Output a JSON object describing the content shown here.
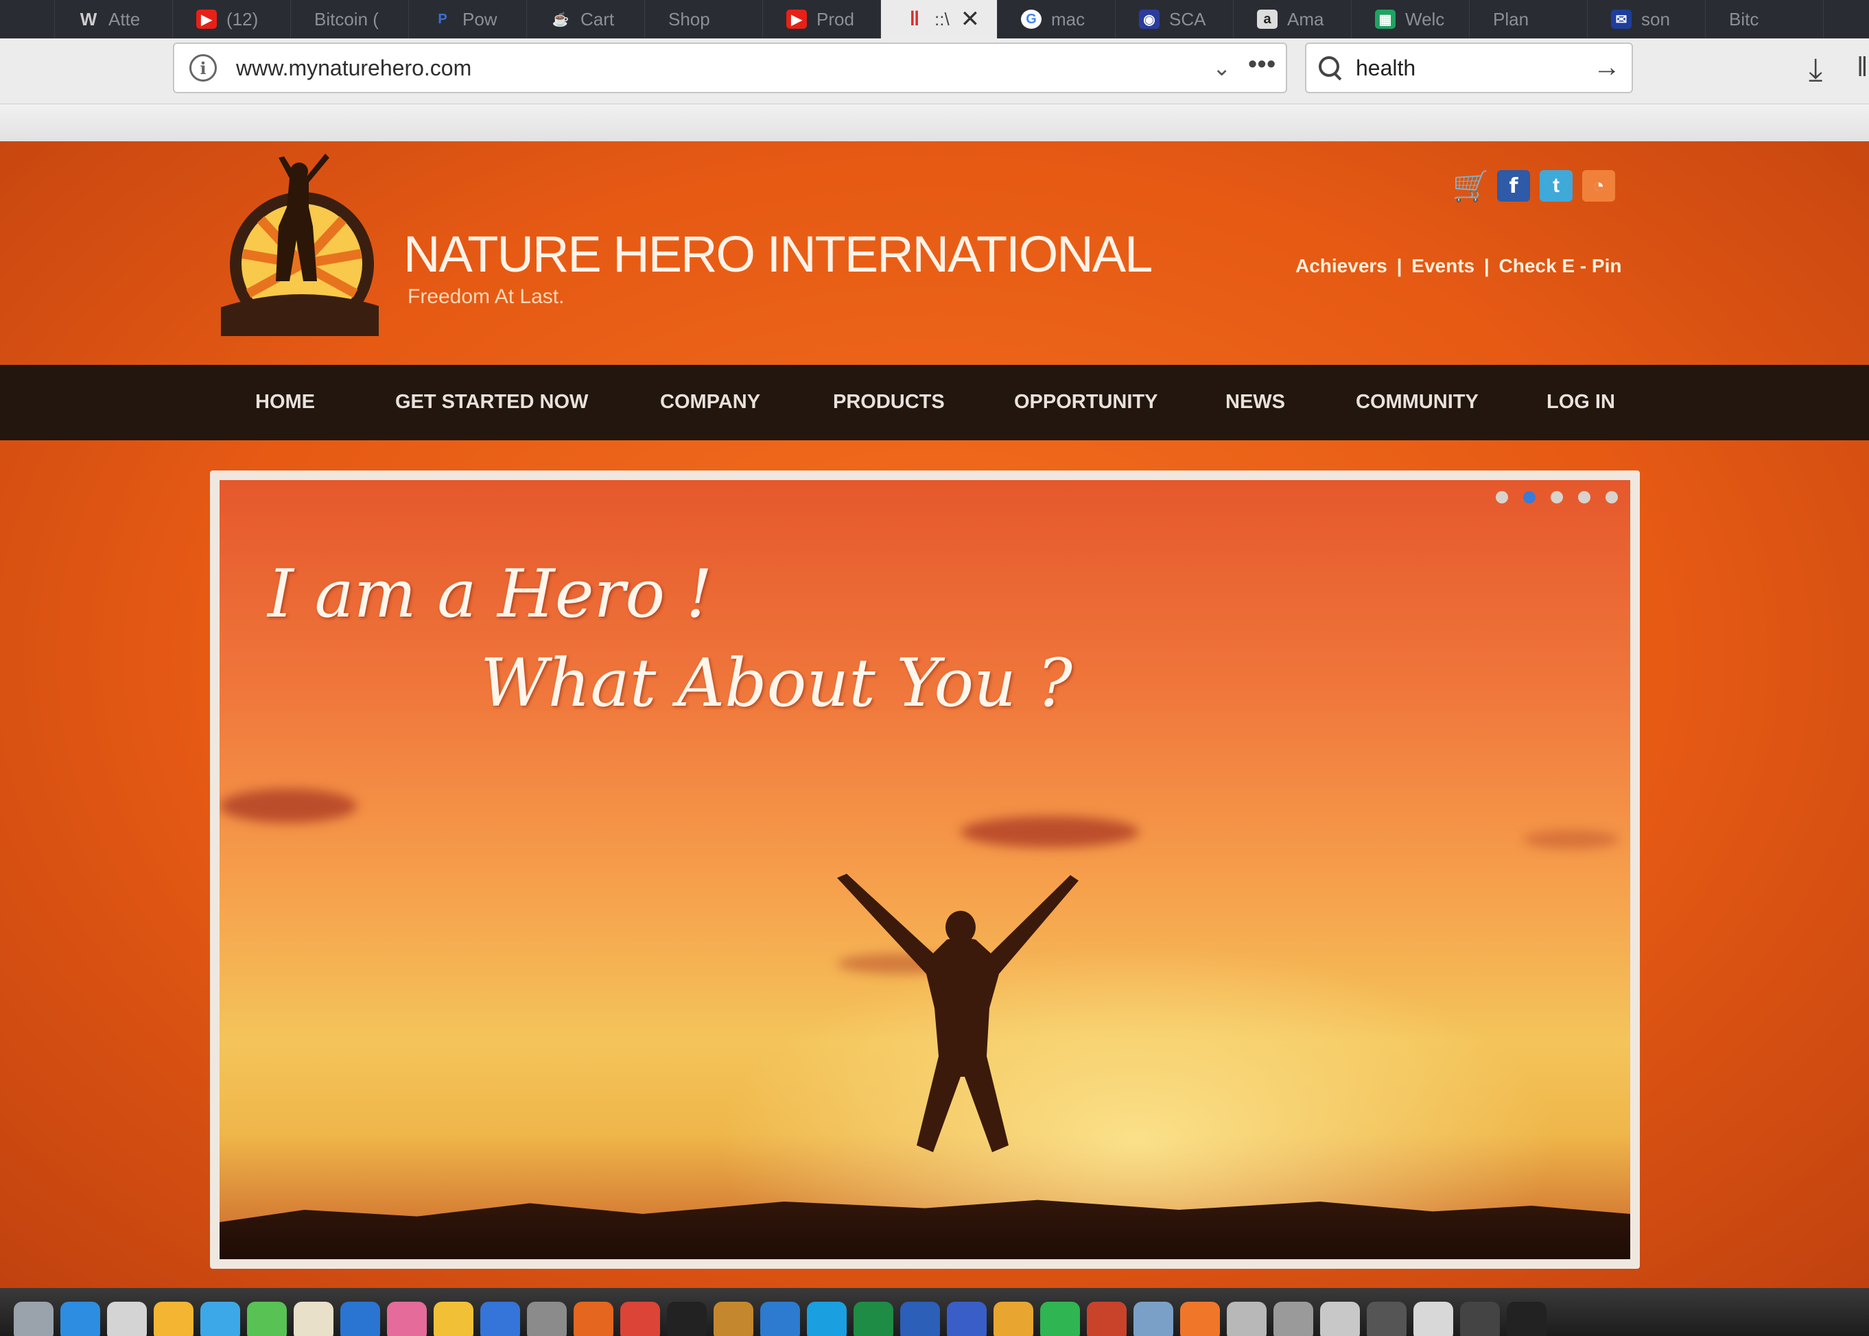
{
  "browser": {
    "tabs": [
      {
        "label": "",
        "color": "#6c6e74"
      },
      {
        "label": "Atte",
        "icon": "W",
        "color": "#555"
      },
      {
        "label": "(12)",
        "icon": "▶",
        "color": "#e62117"
      },
      {
        "label": "Bitcoin (",
        "icon": "",
        "color": "#555"
      },
      {
        "label": "Pow",
        "icon": "P",
        "color": "#2a5ab8"
      },
      {
        "label": "Cart",
        "icon": "☕",
        "color": "#555"
      },
      {
        "label": "Shop",
        "icon": "",
        "color": "#555"
      },
      {
        "label": "Prod",
        "icon": "▶",
        "color": "#e62117"
      },
      {
        "label": "::\\",
        "icon": "‖",
        "color": "#d82f2f",
        "active": true
      },
      {
        "label": "mac",
        "icon": "G",
        "color": "#4285f4"
      },
      {
        "label": "SCA",
        "icon": "◉",
        "color": "#2b3c9e"
      },
      {
        "label": "Ama",
        "icon": "a",
        "color": "#444"
      },
      {
        "label": "Welc",
        "icon": "▦",
        "color": "#1ea362"
      },
      {
        "label": "Plan",
        "icon": "",
        "color": "#555"
      },
      {
        "label": "son",
        "icon": "✉",
        "color": "#1d3e9c"
      },
      {
        "label": "Bitc",
        "icon": "",
        "color": "#555"
      }
    ],
    "url": "www.mynaturehero.com",
    "search_value": "health"
  },
  "site": {
    "title": "NATURE HERO INTERNATIONAL",
    "tagline": "Freedom At Last.",
    "toplinks": {
      "achievers": "Achievers",
      "events": "Events",
      "check_epin": "Check E - Pin",
      "separator": "|"
    },
    "nav": [
      "HOME",
      "GET STARTED NOW",
      "COMPANY",
      "PRODUCTS",
      "OPPORTUNITY",
      "NEWS",
      "COMMUNITY",
      "LOG IN"
    ],
    "slider": {
      "line1": "I am a Hero !",
      "line2": "What About You ?",
      "total_slides": 5,
      "active_slide": 2
    },
    "colors": {
      "brand_orange": "#e65a14",
      "nav_bar": "#22160f",
      "slider_border": "#efe8e0",
      "dot_active": "#3a7bd5"
    },
    "social_icons": [
      "cart-icon",
      "facebook-icon",
      "twitter-icon",
      "rss-icon"
    ]
  }
}
